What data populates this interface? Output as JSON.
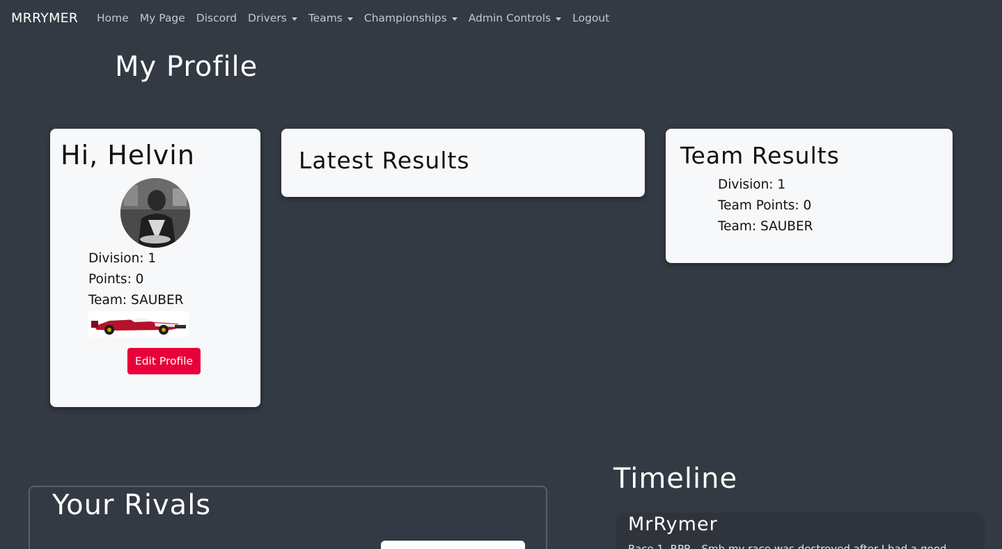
{
  "navbar": {
    "brand": "MRRYMER",
    "items": [
      {
        "label": "Home",
        "dropdown": false
      },
      {
        "label": "My Page",
        "dropdown": false
      },
      {
        "label": "Discord",
        "dropdown": false
      },
      {
        "label": "Drivers",
        "dropdown": true
      },
      {
        "label": "Teams",
        "dropdown": true
      },
      {
        "label": "Championships",
        "dropdown": true
      },
      {
        "label": "Admin Controls",
        "dropdown": true
      },
      {
        "label": "Logout",
        "dropdown": false
      }
    ]
  },
  "page_title": "My Profile",
  "profile": {
    "greeting": "Hi, Helvin",
    "division": "Division: 1",
    "points": "Points: 0",
    "team": "Team: SAUBER",
    "edit_button": "Edit Profile"
  },
  "latest_results": {
    "title": "Latest Results"
  },
  "team_results": {
    "title": "Team Results",
    "division": "Division: 1",
    "team_points": "Team Points: 0",
    "team": "Team: SAUBER"
  },
  "rivals": {
    "title": "Your Rivals"
  },
  "timeline": {
    "title": "Timeline",
    "posts": [
      {
        "author": "MrRymer",
        "text": "Race 1, RPR - Smh my race was destroyed after I had a good"
      }
    ]
  },
  "colors": {
    "background": "#343a43",
    "card": "#f7f8fa",
    "accent_button": "#e8003a",
    "nav_text": "#c5c8cc"
  }
}
